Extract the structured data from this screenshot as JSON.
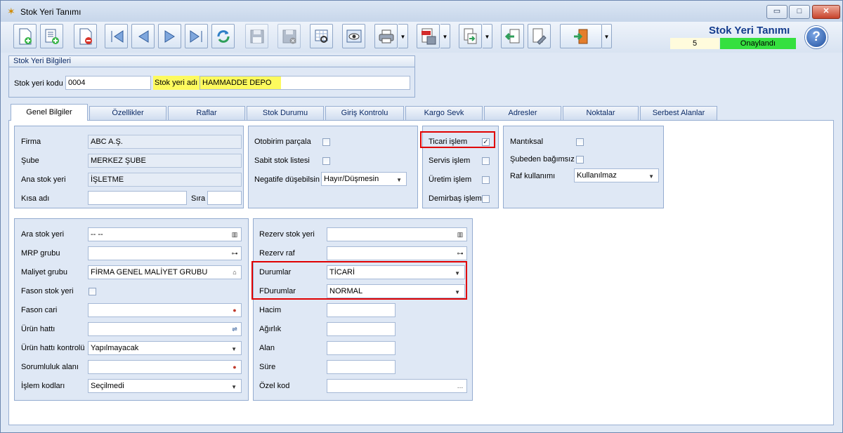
{
  "window": {
    "title": "Stok Yeri Tanımı",
    "min_label": "▭",
    "max_label": "□",
    "close_label": "✕"
  },
  "header": {
    "title": "Stok Yeri Tanımı",
    "count": "5",
    "status": "Onaylandı",
    "status_color": "#35e03f",
    "help_label": "?"
  },
  "toolbar": {
    "icons": [
      "new-record-icon",
      "add-list-icon",
      "delete-record-icon",
      "first-record-icon",
      "previous-record-icon",
      "next-record-icon",
      "last-record-icon",
      "refresh-icon",
      "save-icon",
      "save-cancel-icon",
      "grid-search-icon",
      "preview-icon",
      "print-icon",
      "pdf-export-icon",
      "export-icon",
      "import-icon",
      "tools-icon",
      "exit-icon"
    ]
  },
  "stok_yeri_bilgileri": {
    "title": "Stok Yeri Bilgileri",
    "kod_label": "Stok yeri kodu",
    "kod_value": "0004",
    "ad_label": "Stok yeri adı",
    "ad_value": "HAMMADDE DEPO",
    "highlight_color": "#fdfa5e"
  },
  "tabs": [
    {
      "label": "Genel Bilgiler",
      "active": true
    },
    {
      "label": "Özellikler"
    },
    {
      "label": "Raflar"
    },
    {
      "label": "Stok Durumu"
    },
    {
      "label": "Giriş Kontrolu"
    },
    {
      "label": "Kargo Sevk"
    },
    {
      "label": "Adresler"
    },
    {
      "label": "Noktalar"
    },
    {
      "label": "Serbest Alanlar"
    }
  ],
  "genel": {
    "firma_label": "Firma",
    "firma_value": "ABC A.Ş.",
    "sube_label": "Şube",
    "sube_value": "MERKEZ ŞUBE",
    "ana_label": "Ana stok yeri",
    "ana_value": "İŞLETME",
    "kisa_label": "Kısa adı",
    "kisa_value": "",
    "sira_label": "Sıra",
    "sira_value": ""
  },
  "otobirim": {
    "otobirim_label": "Otobirim parçala",
    "sabit_label": "Sabit stok listesi",
    "negatif_label": "Negatife düşebilsin",
    "negatif_value": "Hayır/Düşmesin"
  },
  "islem": {
    "ticari_label": "Ticari işlem",
    "ticari_checked": "✓",
    "servis_label": "Servis işlem",
    "uretim_label": "Üretim işlem",
    "demirbas_label": "Demirbaş işlem"
  },
  "mantiksal": {
    "mantiksal_label": "Mantıksal",
    "subeden_label": "Şubeden bağımsız",
    "raf_label": "Raf kullanımı",
    "raf_value": "Kullanılmaz"
  },
  "ara": {
    "ara_label": "Ara stok yeri",
    "ara_value": "-- --",
    "mrp_label": "MRP grubu",
    "mrp_value": "",
    "maliyet_label": "Maliyet grubu",
    "maliyet_value": "FİRMA GENEL MALİYET GRUBU",
    "fason_label": "Fason stok yeri",
    "fason_cari_label": "Fason cari",
    "fason_cari_value": "",
    "urun_hatti_label": "Ürün hattı",
    "urun_hatti_value": "",
    "urun_kontrol_label": "Ürün hattı kontrolü",
    "urun_kontrol_value": "Yapılmayacak",
    "sorumluluk_label": "Sorumluluk alanı",
    "sorumluluk_value": "",
    "islem_kod_label": "İşlem kodları",
    "islem_kod_value": "Seçilmedi"
  },
  "rezerv": {
    "rezerv_label": "Rezerv stok yeri",
    "rezerv_value": "",
    "rezerv_raf_label": "Rezerv raf",
    "rezerv_raf_value": "",
    "durumlar_label": "Durumlar",
    "durumlar_value": "TİCARİ",
    "fdurumlar_label": "FDurumlar",
    "fdurumlar_value": "NORMAL",
    "hacim_label": "Hacim",
    "hacim_value": "",
    "agirlik_label": "Ağırlık",
    "agirlik_value": "",
    "alan_label": "Alan",
    "alan_value": "",
    "sure_label": "Süre",
    "sure_value": "",
    "ozel_label": "Özel kod",
    "ozel_value": ""
  }
}
